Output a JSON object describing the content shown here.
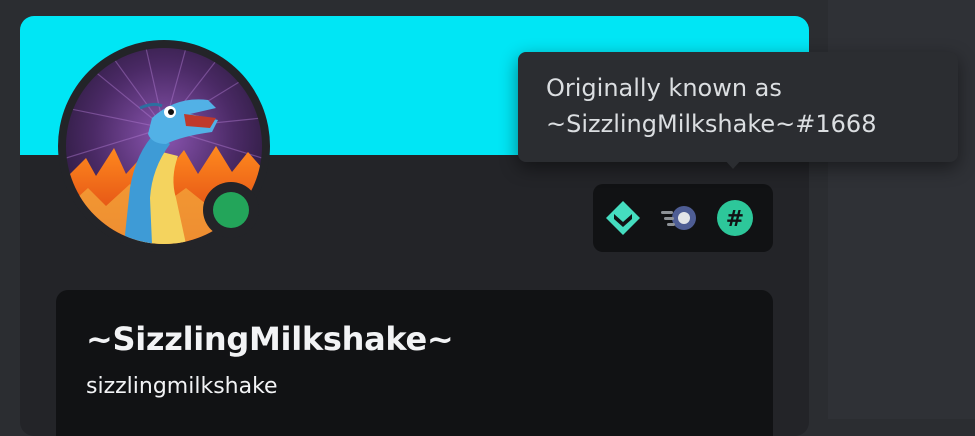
{
  "profile": {
    "display_name": "~SizzlingMilkshake~",
    "username": "sizzlingmilkshake",
    "status": "online",
    "banner_color": "#00e6f5",
    "status_color": "#23a55a",
    "avatar_icon": "dinosaur-avatar"
  },
  "badges": [
    {
      "icon": "hypesquad-balance-icon",
      "color": "#45ddc0"
    },
    {
      "icon": "nitro-orb-icon",
      "color": "#b9bbbe"
    },
    {
      "icon": "originally-known-as-hash-icon",
      "color": "#2dc79a"
    }
  ],
  "tooltip": {
    "line1": "Originally known as",
    "line2": "~SizzlingMilkshake~#1668"
  }
}
